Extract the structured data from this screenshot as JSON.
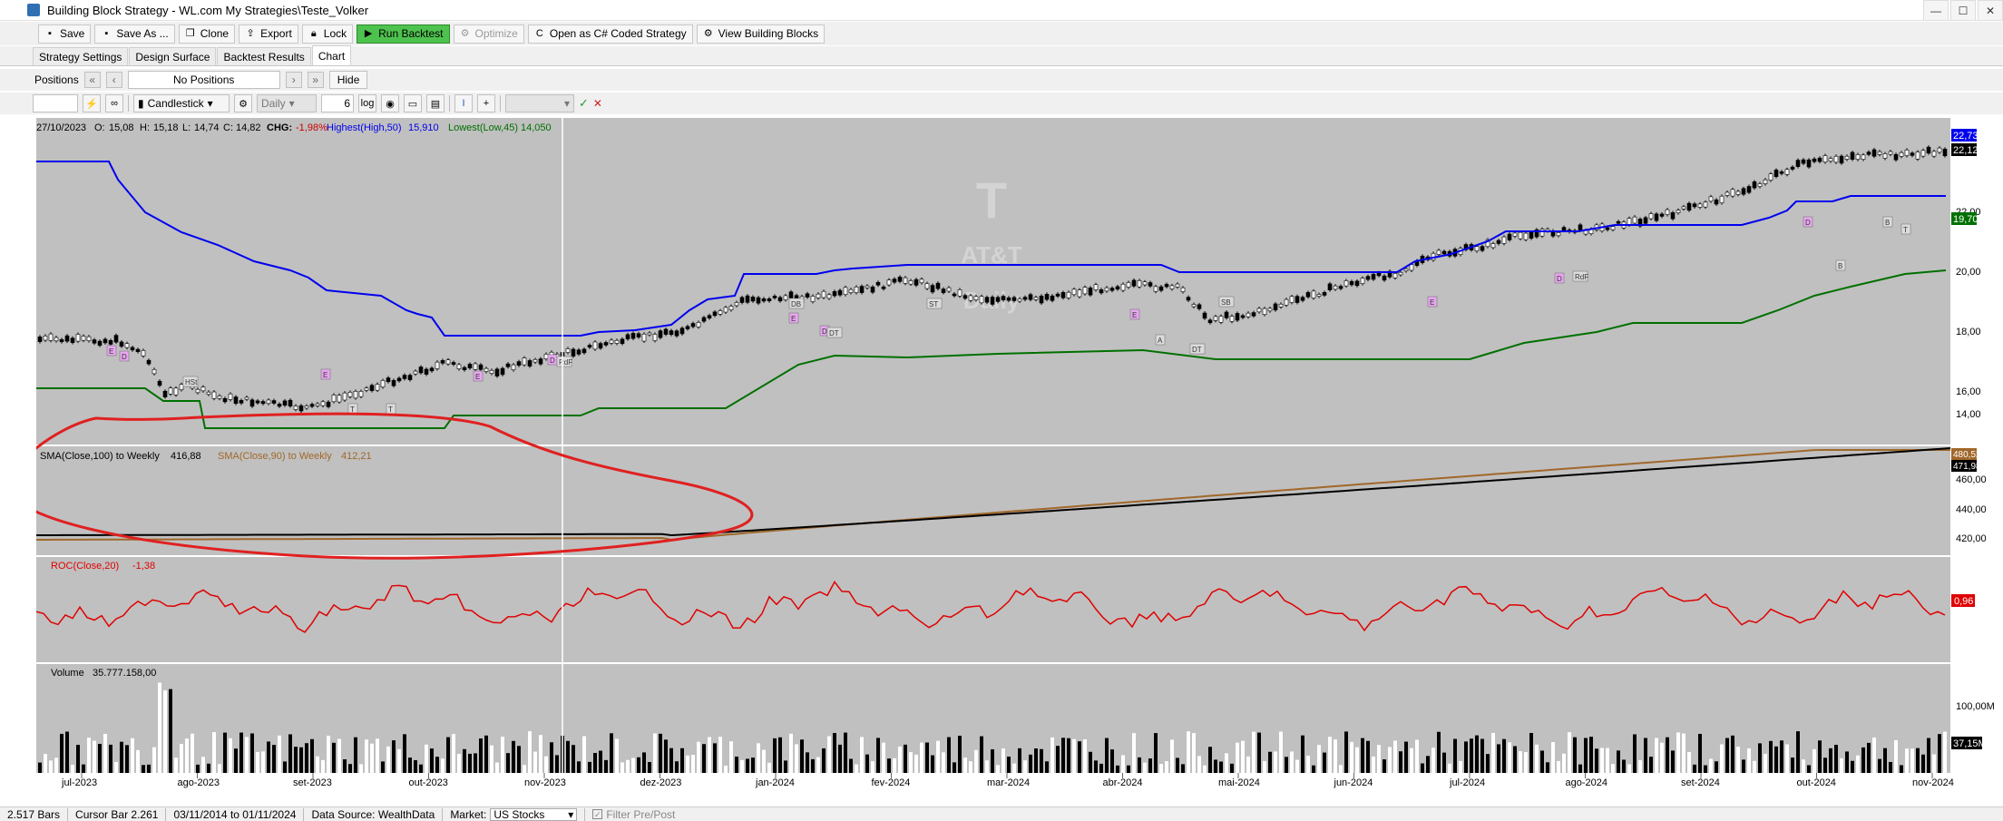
{
  "window": {
    "title": "Building Block Strategy - WL.com My Strategies\\Teste_Volker",
    "minimize": "—",
    "maximize": "☐",
    "close": "✕"
  },
  "toolbar": {
    "save": "Save",
    "save_as": "Save As ...",
    "clone": "Clone",
    "export": "Export",
    "lock": "Lock",
    "run_backtest": "Run Backtest",
    "optimize": "Optimize",
    "open_csharp": "Open as C# Coded Strategy",
    "view_blocks": "View Building Blocks"
  },
  "tabs": [
    "Strategy Settings",
    "Design Surface",
    "Backtest Results",
    "Chart"
  ],
  "active_tab": "Chart",
  "positions_bar": {
    "label": "Positions",
    "first": "«",
    "prev": "‹",
    "center": "No Positions",
    "next": "›",
    "last": "»",
    "hide": "Hide"
  },
  "chart_toolbar": {
    "symbol": "",
    "chart_style": "Candlestick",
    "scale": "Daily",
    "bar_spacing": "6",
    "log": "log",
    "cursor": "I",
    "crosshair": "+",
    "ok": "✓",
    "cancel": "✕"
  },
  "price_pane": {
    "header_date": "27/10/2023",
    "o_label": "O:",
    "o": "15,08",
    "h_label": "H:",
    "h": "15,18",
    "l_label": "L:",
    "l": "14,74",
    "c_label": "C:",
    "c": "14,82",
    "chg_label": "CHG:",
    "chg": "-1,98%",
    "hh_label": "Highest(High,50)",
    "hh_value": "15,910",
    "ll_label": "Lowest(Low,45)",
    "ll_value": "14,050",
    "yticks": [
      "22,00",
      "20,00",
      "18,00",
      "16,00",
      "14,00"
    ],
    "last_high": "22,73",
    "last_close": "22,12",
    "last_low": "19,70",
    "watermark_symbol": "T",
    "watermark_name": "AT&T",
    "watermark_sub": "Daily"
  },
  "sma_pane": {
    "label1": "SMA(Close,100) to Weekly",
    "value1": "416,88",
    "label2": "SMA(Close,90) to Weekly",
    "value2": "412,21",
    "yticks": [
      "460,00",
      "440,00",
      "420,00"
    ],
    "last1": "471,98",
    "last2": "480,52"
  },
  "roc_pane": {
    "label": "ROC(Close,20)",
    "value": "-1,38",
    "last": "0,96"
  },
  "volume_pane": {
    "label": "Volume",
    "value": "35.777.158,00",
    "ytick": "100,00M",
    "last": "37,15M"
  },
  "x_labels": [
    "jul-2023",
    "ago-2023",
    "set-2023",
    "out-2023",
    "nov-2023",
    "dez-2023",
    "jan-2024",
    "fev-2024",
    "mar-2024",
    "abr-2024",
    "mai-2024",
    "jun-2024",
    "jul-2024",
    "ago-2024",
    "set-2024",
    "out-2024",
    "nov-2024"
  ],
  "signals": [
    "E",
    "D",
    "E",
    "E",
    "D",
    "E",
    "D",
    "E",
    "E",
    "D",
    "D",
    "B",
    "B",
    "T",
    "T",
    "T",
    "DB",
    "SB",
    "RdF",
    "RdF",
    "HSt",
    "DT",
    "A",
    "ST",
    "DT"
  ],
  "colors": {
    "chart_bg": "#c0c0c0",
    "highest": "#0000ee",
    "lowest": "#007000",
    "roc": "#e00000",
    "sma100": "#000000",
    "sma90": "#a0682a",
    "annotation": "#e02020"
  },
  "status": {
    "bars": "2.517 Bars",
    "cursor": "Cursor Bar 2.261",
    "range": "03/11/2014 to 01/11/2024",
    "data_source": "Data Source: WealthData",
    "market_label": "Market:",
    "market": "US Stocks",
    "filter": "Filter Pre/Post"
  }
}
